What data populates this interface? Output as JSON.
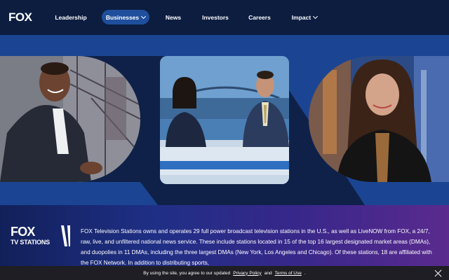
{
  "brand": {
    "logo_text": "FOX"
  },
  "nav": {
    "items": [
      {
        "label": "Leadership",
        "has_dropdown": false,
        "active": false
      },
      {
        "label": "Businesses",
        "has_dropdown": true,
        "active": true
      },
      {
        "label": "News",
        "has_dropdown": false,
        "active": false
      },
      {
        "label": "Investors",
        "has_dropdown": false,
        "active": false
      },
      {
        "label": "Careers",
        "has_dropdown": false,
        "active": false
      },
      {
        "label": "Impact",
        "has_dropdown": true,
        "active": false
      }
    ]
  },
  "hero": {
    "photos": [
      {
        "name": "presenter-left",
        "subject": "man in dark suit smiling, bridge in background"
      },
      {
        "name": "news-anchors",
        "subject": "two news anchors at a studio desk"
      },
      {
        "name": "presenter-right",
        "subject": "woman in dark blazer smiling, city at dusk"
      }
    ]
  },
  "info": {
    "logo_line1": "FOX",
    "logo_line2": "TV STATIONS",
    "description": "FOX Television Stations owns and operates 29 full power broadcast television stations in the U.S., as well as LiveNOW from FOX, a 24/7, raw, live, and unfiltered national news service. These include stations located in 15 of the top 16 largest designated market areas (DMAs), and duopolies in 11 DMAs, including the three largest DMAs (New York, Los Angeles and Chicago). Of these stations, 18 are affiliated with the FOX Network. In addition to distributing sports,"
  },
  "cookie_bar": {
    "text_before": "By using the site, you agree to our updated",
    "privacy_link": "Privacy Policy",
    "and": "and",
    "terms_link": "Terms of Use",
    "text_after": "."
  },
  "colors": {
    "nav_bg": "#0c1d40",
    "active_pill": "#1f4f9c",
    "hero_band": "#1b4592",
    "cookie_bg": "#1e1e24"
  }
}
